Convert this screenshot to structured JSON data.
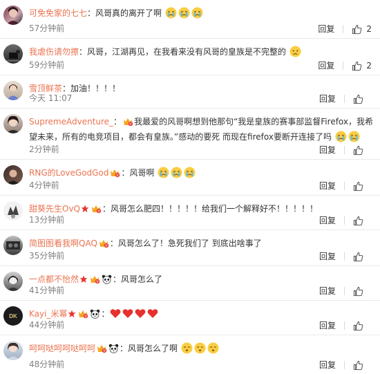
{
  "comments": [
    {
      "name": "可免免家的七七",
      "text": "风哥真的离开了啊",
      "emoji": [
        "cry",
        "cry",
        "cry"
      ],
      "time": "57分钟前",
      "reply": "回复",
      "likes": "2"
    },
    {
      "name": "我虐伤请勿擦",
      "text": "风哥，江湖再见，在我看来没有风哥的皇族是不完整的",
      "emoji": [
        "sad"
      ],
      "time": "59分钟前",
      "reply": "回复",
      "likes": "2"
    },
    {
      "name": "雪顶鲜茶",
      "text": "加油！！！！",
      "emoji": [],
      "time": "今天 11:07",
      "reply": "回复",
      "likes": ""
    },
    {
      "name": "SupremeAdventure_",
      "text": "我最爱的风哥啊想到他那句“我是皇族的赛事部监督Firefox，我希望未来，所有的电竞项目，都会有皇族。”感动的要死 而现在firefox要断开连接了吗",
      "emoji": [
        "cry",
        "cry"
      ],
      "time": "2分钟前",
      "reply": "回复",
      "likes": ""
    },
    {
      "name": "RNG的LoveGodGod",
      "text": "风哥啊",
      "emoji": [
        "cry",
        "cry",
        "cry"
      ],
      "time": "4分钟前",
      "reply": "回复",
      "likes": ""
    },
    {
      "name": "甜葵先生OvQ",
      "text": "风哥怎么肥四！！！！！给我们一个解释好不！！！！！",
      "emoji": [],
      "time": "13分钟前",
      "reply": "回复",
      "likes": ""
    },
    {
      "name": "简图图看我啊QAQ",
      "text": "风哥怎么了！急死我们了 到底出啥事了",
      "emoji": [],
      "time": "35分钟前",
      "reply": "回复",
      "likes": ""
    },
    {
      "name": "一点都不怡然",
      "text": "风哥怎么了",
      "emoji": [],
      "time": "41分钟前",
      "reply": "回复",
      "likes": ""
    },
    {
      "name": "Kayi_米幂",
      "text": "",
      "emoji": [
        "heart",
        "heart",
        "heart",
        "heart"
      ],
      "time": "44分钟前",
      "reply": "回复",
      "likes": ""
    },
    {
      "name": "呵呵哒呵呵哒呵呵",
      "text": "风哥怎么了啊",
      "emoji": [
        "puzzled",
        "puzzled",
        "puzzled"
      ],
      "time": "48分钟前",
      "reply": "回复",
      "likes": ""
    }
  ],
  "colors": {
    "name": "#eb7350",
    "meta": "#808080",
    "divider": "#eaeaea"
  }
}
